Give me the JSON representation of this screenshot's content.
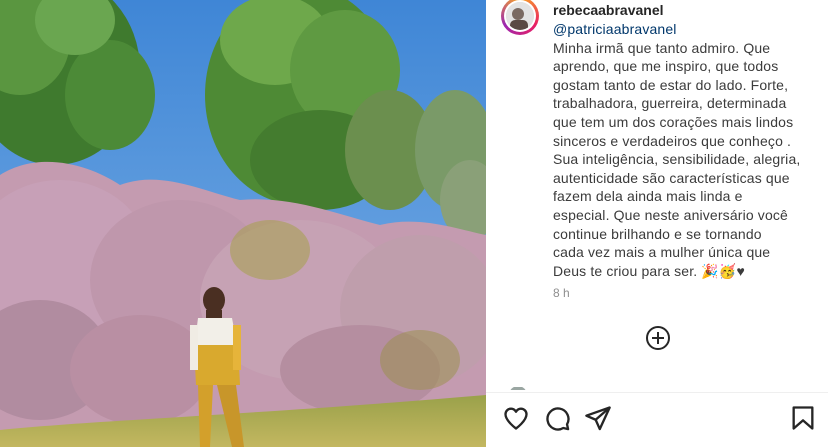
{
  "post": {
    "username": "rebecaabravanel",
    "mention": "@patriciaabravanel",
    "caption": "Minha irmã que tanto admiro. Que\naprendo, que me inspiro, que todos\ngostam tanto de estar do lado. Forte,\ntrabalhadora, guerreira, determinada\nque tem um dos corações mais lindos\nsinceros e verdadeiros que conheço .\nSua inteligência, sensibilidade, alegria,\nautenticidade são características que\nfazem dela ainda mais linda e\nespecial. Que neste aniversário você\ncontinue brilhando e se tornando\ncada vez mais a mulher única que\nDeus te criou para ser. 🎉🥳♥",
    "timestamp": "8 h"
  },
  "icons": {
    "add_comment": "plus-circle-icon",
    "like": "heart-icon",
    "comment": "comment-icon",
    "share": "paper-plane-icon",
    "save": "bookmark-icon"
  },
  "colors": {
    "mention": "#00376b",
    "timestamp": "#8e8e8e",
    "sky": "#4a8fd8",
    "flowers": "#c9a3b5"
  }
}
